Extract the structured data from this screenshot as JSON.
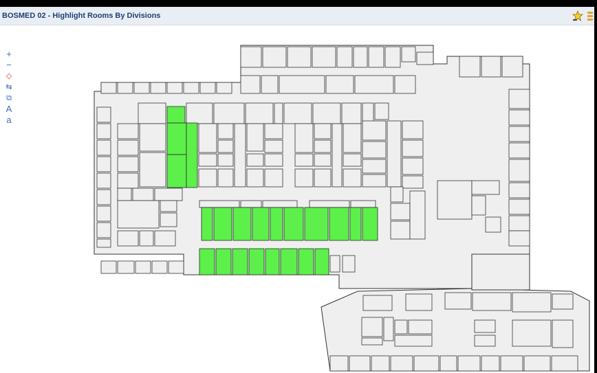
{
  "window": {
    "title": "BOSMED 02 - Highlight Rooms By Divisions",
    "favorite_icon": "star-icon",
    "menu_icon": "overflow-icon"
  },
  "toolbar": {
    "tools": [
      {
        "name": "zoom-in-tool",
        "glyph": "+"
      },
      {
        "name": "zoom-out-tool",
        "glyph": "−"
      },
      {
        "name": "zoom-extents-tool",
        "glyph": "◇"
      },
      {
        "name": "pan-tool",
        "glyph": "⇆"
      },
      {
        "name": "select-tool",
        "glyph": "⧉"
      },
      {
        "name": "text-large-tool",
        "glyph": "A"
      },
      {
        "name": "text-small-tool",
        "glyph": "a"
      }
    ]
  },
  "legend": {
    "highlight_color": "#5df04a",
    "room_fill": "#efefef",
    "outline": "#333333"
  }
}
